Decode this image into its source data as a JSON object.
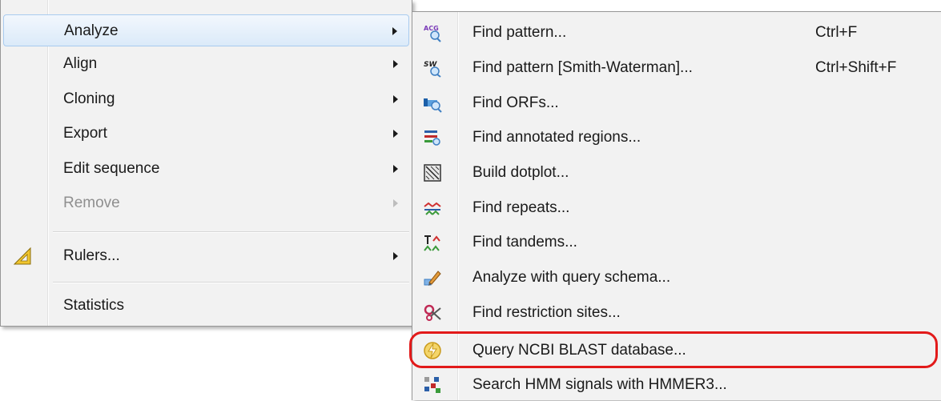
{
  "main_menu": {
    "items": [
      {
        "label": "Analyze"
      },
      {
        "label": "Align"
      },
      {
        "label": "Cloning"
      },
      {
        "label": "Export"
      },
      {
        "label": "Edit sequence"
      },
      {
        "label": "Remove"
      },
      {
        "label": "Rulers..."
      },
      {
        "label": "Statistics"
      }
    ]
  },
  "analyze_submenu": {
    "items": [
      {
        "label": "Find pattern...",
        "shortcut": "Ctrl+F",
        "icon": "find-pattern-icon"
      },
      {
        "label": "Find pattern [Smith-Waterman]...",
        "shortcut": "Ctrl+Shift+F",
        "icon": "smith-waterman-icon"
      },
      {
        "label": "Find ORFs...",
        "icon": "find-orfs-icon"
      },
      {
        "label": "Find annotated regions...",
        "icon": "annotated-regions-icon"
      },
      {
        "label": "Build dotplot...",
        "icon": "dotplot-icon"
      },
      {
        "label": "Find repeats...",
        "icon": "repeats-icon"
      },
      {
        "label": "Find tandems...",
        "icon": "tandems-icon"
      },
      {
        "label": "Analyze with query schema...",
        "icon": "query-schema-icon"
      },
      {
        "label": "Find restriction sites...",
        "icon": "restriction-sites-icon"
      },
      {
        "label": "Query NCBI BLAST database...",
        "icon": "blast-icon"
      },
      {
        "label": "Search HMM signals with HMMER3...",
        "icon": "hmm-icon"
      }
    ],
    "icon_texts": {
      "acg": "ACG",
      "sw": "SW"
    }
  },
  "colors": {
    "highlight_ring": "#e21a1a",
    "hover_border": "#a8cbef"
  }
}
